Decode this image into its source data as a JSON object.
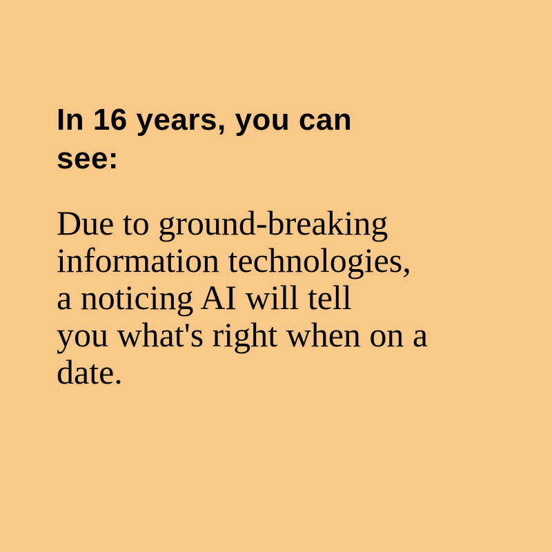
{
  "colors": {
    "background": "#F8C888",
    "text": "#000000"
  },
  "heading": {
    "lines": [
      "In 16 years, you can",
      "see:"
    ]
  },
  "body": {
    "lines": [
      "Due to ground-breaking",
      "information technologies,",
      "a noticing AI will tell",
      "you what's right when on a",
      "date."
    ]
  }
}
